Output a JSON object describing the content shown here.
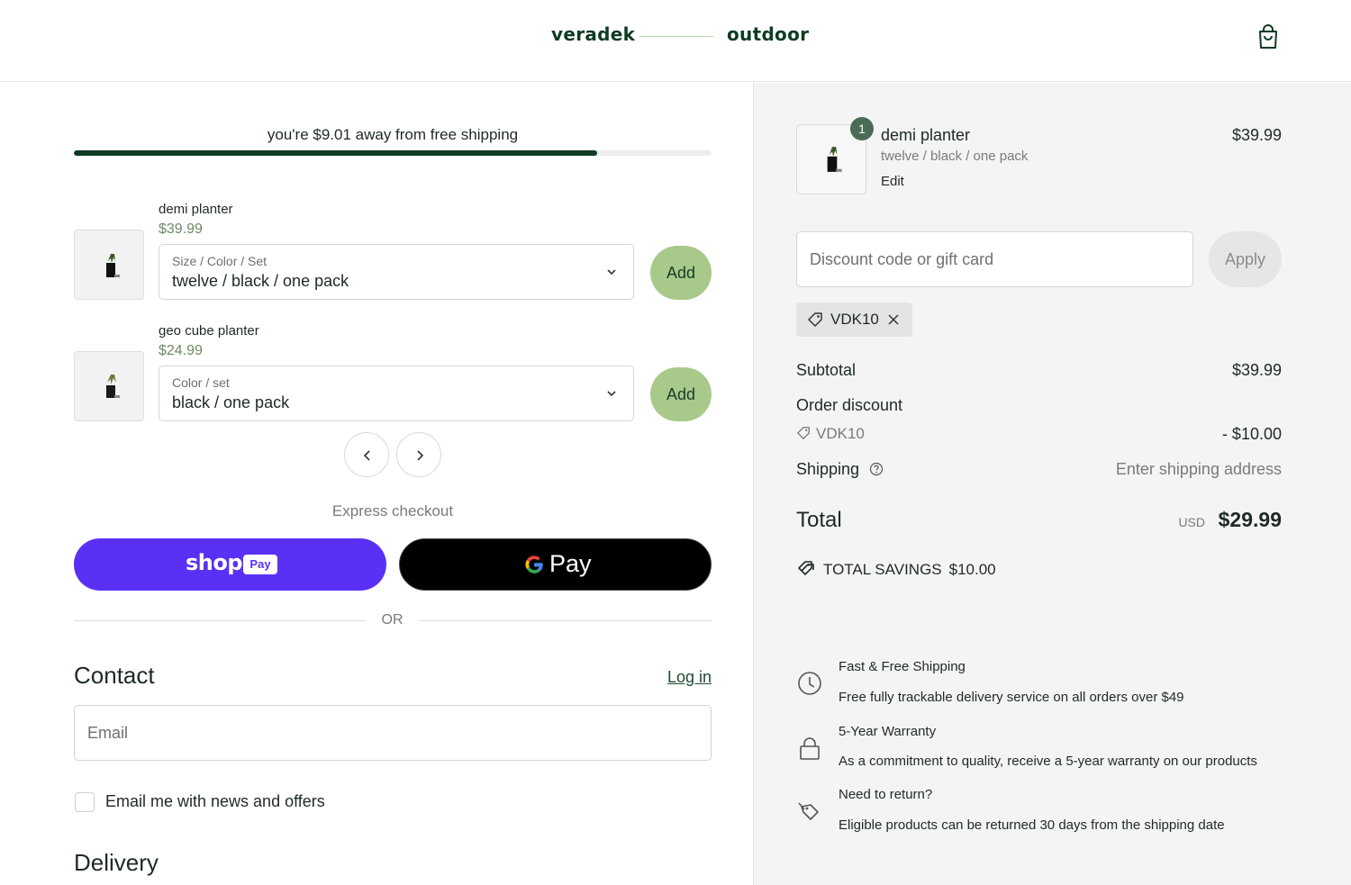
{
  "header": {
    "brand_left": "veradek",
    "brand_right": "outdoor"
  },
  "shipping_progress": {
    "message": "you're $9.01 away from free shipping",
    "fraction": 0.82
  },
  "upsells": [
    {
      "name": "demi planter",
      "price": "$39.99",
      "select_label": "Size / Color / Set",
      "select_value": "twelve / black / one pack",
      "add_label": "Add"
    },
    {
      "name": "geo cube planter",
      "price": "$24.99",
      "select_label": "Color / set",
      "select_value": "black / one pack",
      "add_label": "Add"
    }
  ],
  "express": {
    "label": "Express checkout",
    "shop_text": "shop",
    "shop_badge": "Pay",
    "gpay_text": "Pay",
    "or_text": "OR"
  },
  "contact": {
    "title": "Contact",
    "login": "Log in",
    "email_placeholder": "Email",
    "newsletter_label": "Email me with news and offers"
  },
  "delivery": {
    "title": "Delivery"
  },
  "cart_item": {
    "quantity": "1",
    "name": "demi planter",
    "variant": "twelve / black / one pack",
    "edit": "Edit",
    "price": "$39.99"
  },
  "discount": {
    "placeholder": "Discount code or gift card",
    "apply": "Apply",
    "applied_code": "VDK10"
  },
  "summary": {
    "subtotal_label": "Subtotal",
    "subtotal_value": "$39.99",
    "order_discount_label": "Order discount",
    "discount_code": "VDK10",
    "discount_value": "- $10.00",
    "shipping_label": "Shipping",
    "shipping_value": "Enter shipping address",
    "total_label": "Total",
    "currency": "USD",
    "total_value": "$29.99",
    "savings_label": "TOTAL SAVINGS",
    "savings_value": "$10.00"
  },
  "features": [
    {
      "icon": "clock-icon",
      "title": "Fast & Free Shipping",
      "desc": "Free fully trackable delivery service on all orders over $49"
    },
    {
      "icon": "lock-icon",
      "title": "5-Year Warranty",
      "desc": "As a commitment to quality, receive a 5-year warranty on our products"
    },
    {
      "icon": "return-tag-icon",
      "title": "Need to return?",
      "desc": "Eligible products can be returned 30 days from the shipping date"
    }
  ],
  "colors": {
    "brand_green": "#0d3b24",
    "add_button": "#a9c98a",
    "shop_pay": "#5a31f4",
    "summary_bg": "#f4f4f4"
  }
}
